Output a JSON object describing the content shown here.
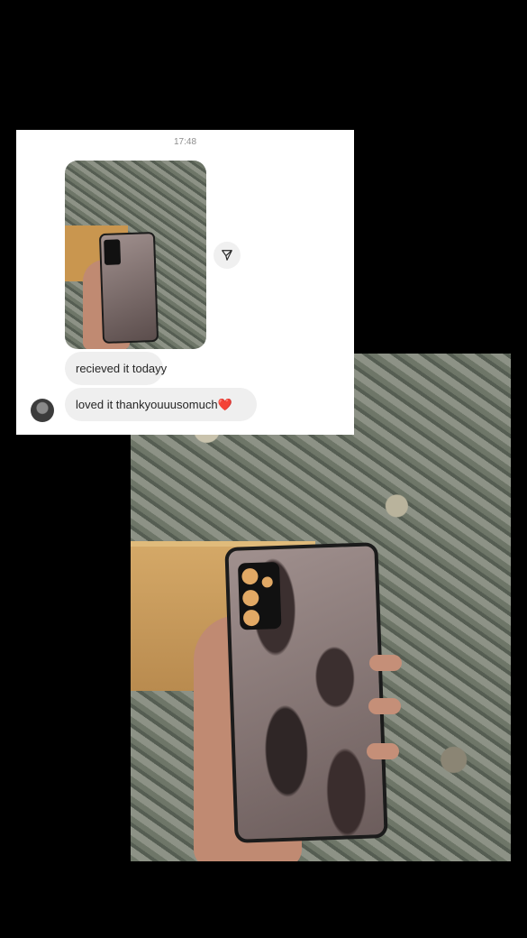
{
  "chat": {
    "timestamp": "17:48",
    "messages": [
      {
        "text": "recieved it todayy"
      },
      {
        "text": "loved it thankyouuusomuch❤️"
      }
    ],
    "share_icon": "send-icon",
    "avatar_icon": "user-avatar"
  },
  "colors": {
    "background": "#000000",
    "chat_background": "#ffffff",
    "bubble": "#efefef",
    "timestamp": "#8e8e8e"
  }
}
